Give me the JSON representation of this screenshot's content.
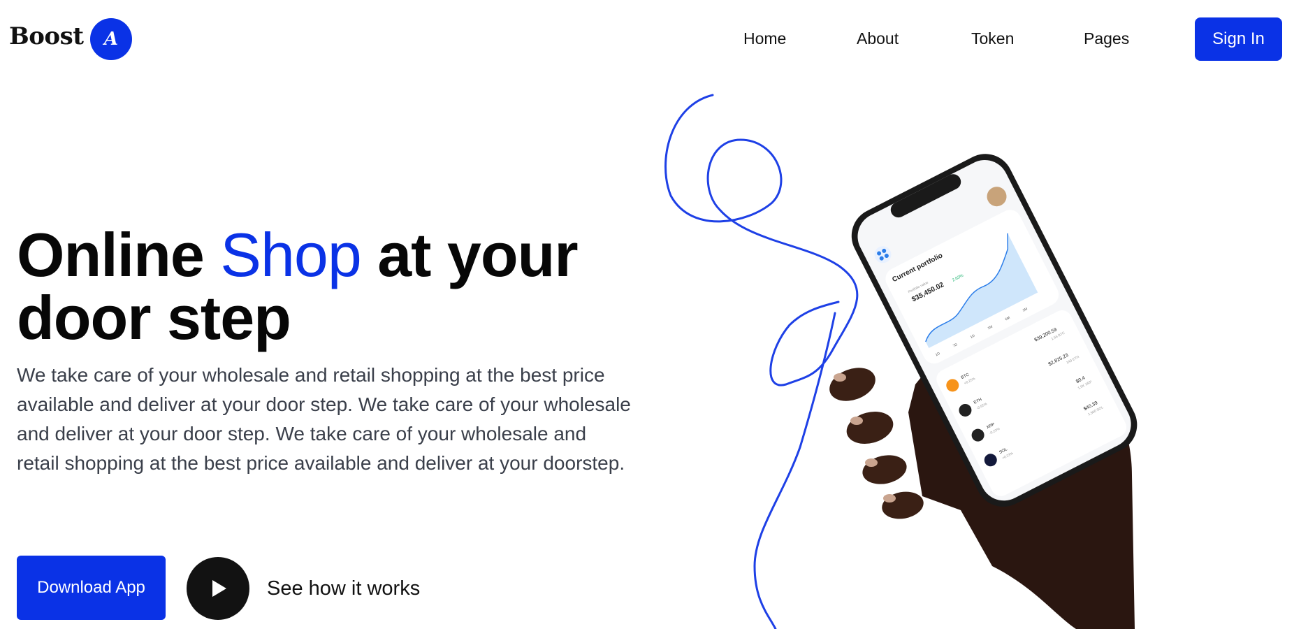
{
  "header": {
    "logo_text": "Boost",
    "logo_badge": "A",
    "nav": [
      "Home",
      "About",
      "Token",
      "Pages"
    ],
    "signin": "Sign In"
  },
  "hero": {
    "headline_part1": "Online ",
    "headline_accent": "Shop",
    "headline_part2": " at your door step",
    "subtext": "We take care of your wholesale and retail shopping at the best price available and deliver at your door step. We take care of your wholesale and deliver at your door step. We take care of your wholesale and retail shopping at the best price available and deliver at your doorstep.",
    "download_label": "Download App",
    "how_label": "See how it works"
  },
  "phone": {
    "card_title": "Current portfolio",
    "value_label": "Portfolio value",
    "value": "$35,450.02",
    "change": "2.63%",
    "ranges": [
      "1D",
      "7D",
      "1D",
      "1M",
      "6M",
      "1M"
    ],
    "assets": [
      {
        "symbol": "BTC",
        "pct": "+0.25%",
        "value": "$39,200.59",
        "amount": "1.56 BTC"
      },
      {
        "symbol": "ETH",
        "pct": "-0.55%",
        "value": "$2,825.23",
        "amount": "140 ETH"
      },
      {
        "symbol": "XRP",
        "pct": "-0.23%",
        "value": "$0.4",
        "amount": "1.5K XRP"
      },
      {
        "symbol": "SOL",
        "pct": "+0.23%",
        "value": "$40.39",
        "amount": "1,500 SOL"
      }
    ]
  },
  "colors": {
    "brand_blue": "#0a32e6",
    "dark": "#121212",
    "body_text": "#3a3f4a"
  },
  "icons": {
    "play": "play-icon",
    "logo": "logo-badge-icon"
  }
}
